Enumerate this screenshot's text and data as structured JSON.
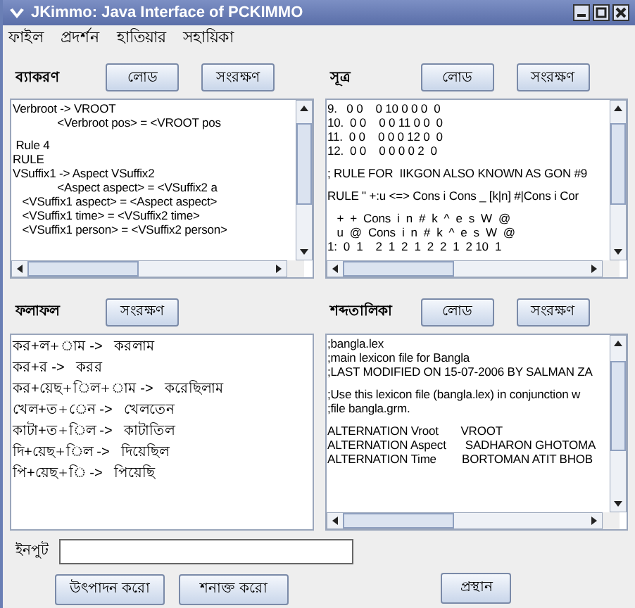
{
  "window": {
    "title": "JKimmo: Java Interface of PCKIMMO"
  },
  "menu": [
    "ফাইল",
    "প্রদর্শন",
    "হাতিয়ার",
    "সহায়িকা"
  ],
  "panels": [
    {
      "kind": "editor",
      "label": "ব্যাকরণ",
      "buttons": [
        "লোড",
        "সংরক্ষণ"
      ],
      "blocks": [
        [
          "Verbroot -> VROOT",
          "              <Verbroot pos> = <VROOT pos"
        ],
        [
          " Rule 4",
          "RULE",
          "VSuffix1 -> Aspect VSuffix2",
          "              <Aspect aspect> = <VSuffix2 a",
          "   <VSuffix1 aspect> = <Aspect aspect>",
          "   <VSuffix1 time> = <VSuffix2 time>",
          "   <VSuffix1 person> = <VSuffix2 person>"
        ]
      ]
    },
    {
      "kind": "editor",
      "label": "সূত্র",
      "buttons": [
        "লোড",
        "সংরক্ষণ"
      ],
      "blocks": [
        [
          "9.   0 0    0 10 0 0 0  0",
          "10.  0 0    0 0 11 0 0  0",
          "11.  0 0    0 0 0 12 0  0",
          "12.  0 0    0 0 0 0 2  0"
        ],
        [
          "; RULE FOR  IIKGON ALSO KNOWN AS GON #9"
        ],
        [
          "RULE \" +:u <=> Cons i Cons _ [k|n] #|Cons i Cor"
        ],
        [
          "   +  +  Cons  i  n  #  k  ^  e  s  W  @",
          "   u  @  Cons  i  n  #  k  ^  e  s  W  @",
          "1:  0  1    2  1  2  1  2  2  1  2 10  1"
        ]
      ]
    },
    {
      "kind": "result",
      "label": "ফলাফল",
      "buttons": [
        "সংরক্ষণ"
      ],
      "blocks": [
        [
          "কর+ল+াম ->   করলাম",
          "কর+র ->   করর",
          "কর+য়েছ+িল+াম ->   করেছিলাম",
          "খেল+ত+েন ->   খেলতেন",
          "কাটা+ত+িল ->   কাটাতিল",
          "দি+য়েছ+িল ->   দিয়েছিল",
          "পি+য়েছ+ি ->   পিয়েছি"
        ]
      ]
    },
    {
      "kind": "editor",
      "label": "শব্দতালিকা",
      "buttons": [
        "লোড",
        "সংরক্ষণ"
      ],
      "blocks": [
        [
          ";bangla.lex",
          ";main lexicon file for Bangla",
          ";LAST MODIFIED ON 15-07-2006 BY SALMAN ZA"
        ],
        [
          ";Use this lexicon file (bangla.lex) in conjunction w",
          ";file bangla.grm."
        ],
        [
          "ALTERNATION Vroot       VROOT",
          "ALTERNATION Aspect      SADHARON GHOTOMA",
          "ALTERNATION Time        BORTOMAN ATIT BHOB"
        ]
      ]
    }
  ],
  "input": {
    "label": "ইনপুট"
  },
  "actions": [
    "উৎপাদন করো",
    "শনাক্ত করো"
  ],
  "exit_button": "প্রস্থান"
}
